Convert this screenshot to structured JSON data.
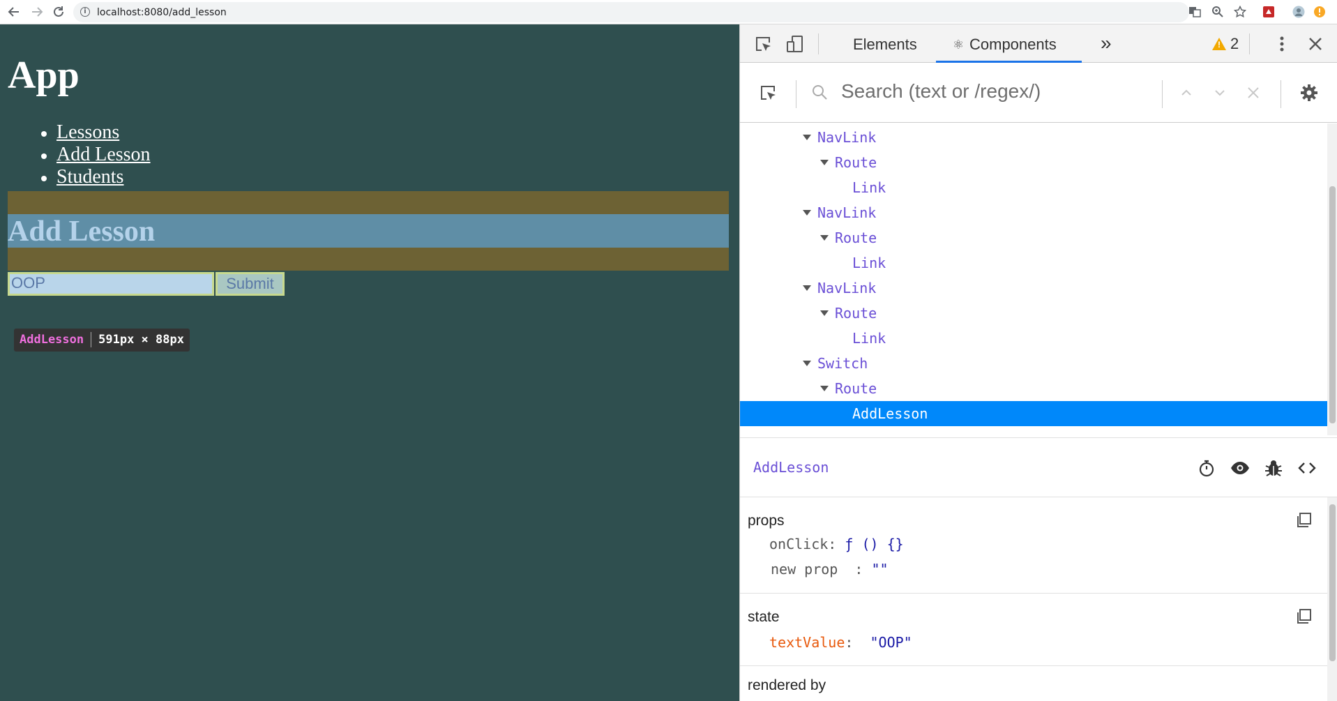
{
  "browser": {
    "url": "localhost:8080/add_lesson"
  },
  "app": {
    "title": "App",
    "nav": [
      "Lessons",
      "Add Lesson",
      "Students"
    ],
    "heading": "Add Lesson",
    "input_value": "OOP",
    "submit_label": "Submit",
    "tooltip": {
      "name": "AddLesson",
      "size": "591px × 88px"
    }
  },
  "devtools": {
    "tabs": {
      "elements": "Elements",
      "components": "Components",
      "more": "»"
    },
    "warning_count": "2",
    "search_placeholder": "Search (text or /regex/)",
    "tree": [
      {
        "label": "NavLink"
      },
      {
        "label": "Route"
      },
      {
        "label": "Link"
      },
      {
        "label": "NavLink"
      },
      {
        "label": "Route"
      },
      {
        "label": "Link"
      },
      {
        "label": "NavLink"
      },
      {
        "label": "Route"
      },
      {
        "label": "Link"
      },
      {
        "label": "Switch"
      },
      {
        "label": "Route"
      },
      {
        "label": "AddLesson"
      }
    ],
    "selected_component": "AddLesson",
    "props": {
      "title": "props",
      "entries": [
        {
          "key": "onClick",
          "value": "ƒ () {}"
        },
        {
          "key": "new prop",
          "value": "\"\""
        }
      ]
    },
    "state": {
      "title": "state",
      "entries": [
        {
          "key": "textValue",
          "value": "\"OOP\""
        }
      ]
    },
    "rendered_by_title": "rendered by"
  },
  "colors": {
    "app_background": "#2f4f4f",
    "selection": "#0088fa",
    "component_name": "#6a4fd6",
    "tab_underline": "#1a73e8"
  }
}
